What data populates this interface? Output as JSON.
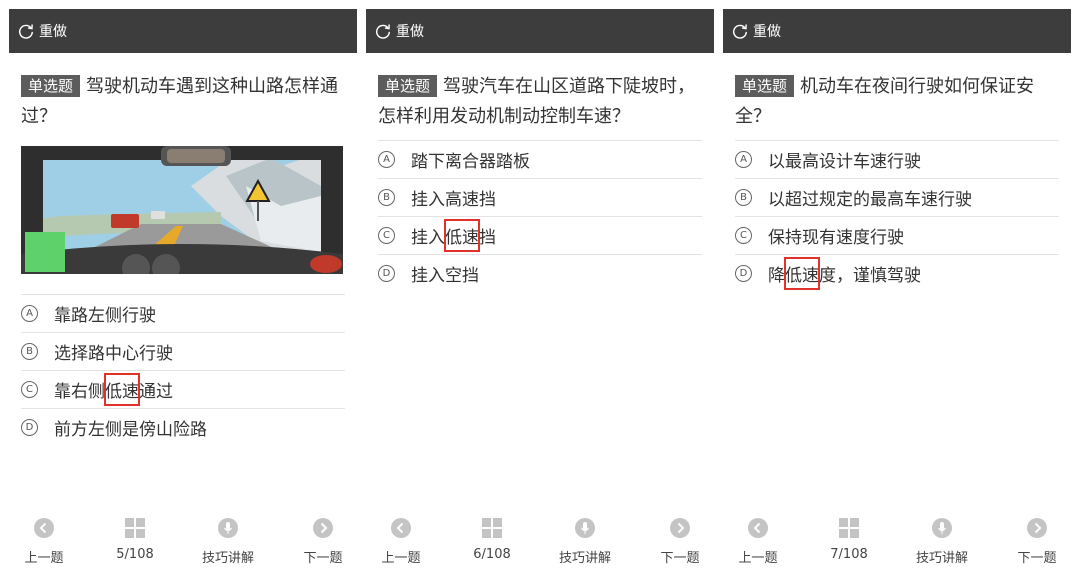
{
  "panels": [
    {
      "redo_label": "重做",
      "question_type": "单选题",
      "question_text": "驾驶机动车遇到这种山路怎样通过？",
      "has_scene": true,
      "options": [
        {
          "letter": "A",
          "parts": [
            "靠路左侧行驶"
          ]
        },
        {
          "letter": "B",
          "parts": [
            "选择路中心行驶"
          ]
        },
        {
          "letter": "C",
          "parts": [
            "靠右侧",
            "低速",
            "通过"
          ]
        },
        {
          "letter": "D",
          "parts": [
            "前方左侧是傍山险路"
          ]
        }
      ],
      "nav": {
        "prev": "上一题",
        "progress": "5/108",
        "skill": "技巧讲解",
        "next": "下一题"
      }
    },
    {
      "redo_label": "重做",
      "question_type": "单选题",
      "question_text": "驾驶汽车在山区道路下陡坡时，怎样利用发动机制动控制车速？",
      "has_scene": false,
      "options": [
        {
          "letter": "A",
          "parts": [
            "踏下离合器踏板"
          ]
        },
        {
          "letter": "B",
          "parts": [
            "挂入高速挡"
          ]
        },
        {
          "letter": "C",
          "parts": [
            "挂入",
            "低速",
            "挡"
          ]
        },
        {
          "letter": "D",
          "parts": [
            "挂入空挡"
          ]
        }
      ],
      "nav": {
        "prev": "上一题",
        "progress": "6/108",
        "skill": "技巧讲解",
        "next": "下一题"
      }
    },
    {
      "redo_label": "重做",
      "question_type": "单选题",
      "question_text": "机动车在夜间行驶如何保证安全？",
      "has_scene": false,
      "options": [
        {
          "letter": "A",
          "parts": [
            "以最高设计车速行驶"
          ]
        },
        {
          "letter": "B",
          "parts": [
            "以超过规定的最高车速行驶"
          ]
        },
        {
          "letter": "C",
          "parts": [
            "保持现有速度行驶"
          ]
        },
        {
          "letter": "D",
          "parts": [
            "降",
            "低速",
            "度，谨慎驾驶"
          ]
        }
      ],
      "nav": {
        "prev": "上一题",
        "progress": "7/108",
        "skill": "技巧讲解",
        "next": "下一题"
      }
    }
  ],
  "colors": {
    "topbar": "#3d3d3d",
    "badge": "#5c5c5c",
    "highlight": "#e0312a",
    "nav_icon": "#c4c4c4"
  },
  "icons": [
    "refresh-icon",
    "prev-circle-icon",
    "grid-icon",
    "microphone-icon",
    "next-circle-icon"
  ]
}
